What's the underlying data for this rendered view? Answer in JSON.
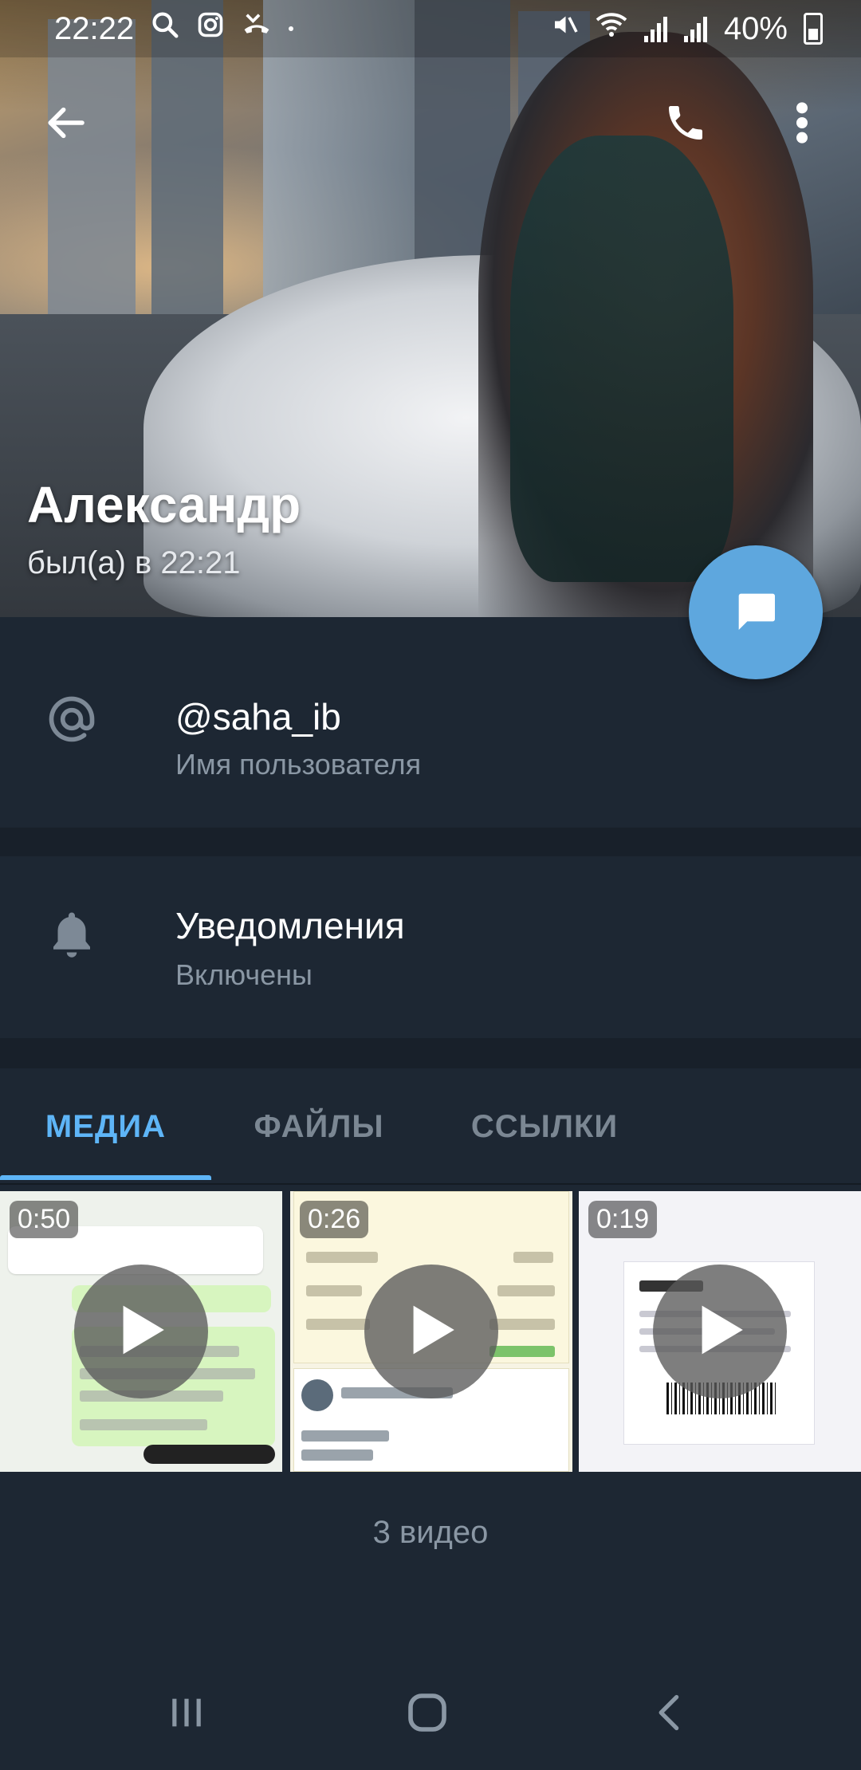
{
  "status_bar": {
    "time": "22:22",
    "battery": "40%",
    "icons": [
      "search-icon",
      "instagram-icon",
      "missed-call-icon",
      "mute-icon",
      "wifi-icon",
      "signal-icon",
      "signal-icon",
      "battery-icon"
    ]
  },
  "header": {
    "back_icon": "arrow-left-icon",
    "call_icon": "phone-icon",
    "menu_icon": "more-vertical-icon"
  },
  "profile": {
    "name": "Александр",
    "last_seen": "был(а) в 22:21",
    "fab_icon": "message-icon"
  },
  "info": {
    "username": {
      "icon": "at-icon",
      "value": "@saha_ib",
      "label": "Имя пользователя"
    },
    "notifications": {
      "icon": "bell-icon",
      "value": "Уведомления",
      "label": "Включены"
    }
  },
  "tabs": [
    {
      "label": "МЕДИА",
      "active": true
    },
    {
      "label": "ФАЙЛЫ",
      "active": false
    },
    {
      "label": "ССЫЛКИ",
      "active": false
    }
  ],
  "media": [
    {
      "duration": "0:50"
    },
    {
      "duration": "0:26"
    },
    {
      "duration": "0:19"
    }
  ],
  "media_count": "3 видео",
  "colors": {
    "background": "#1d2733",
    "accent": "#5eb5f7",
    "fab": "#5ea7de",
    "secondary_text": "#8a97a4"
  }
}
